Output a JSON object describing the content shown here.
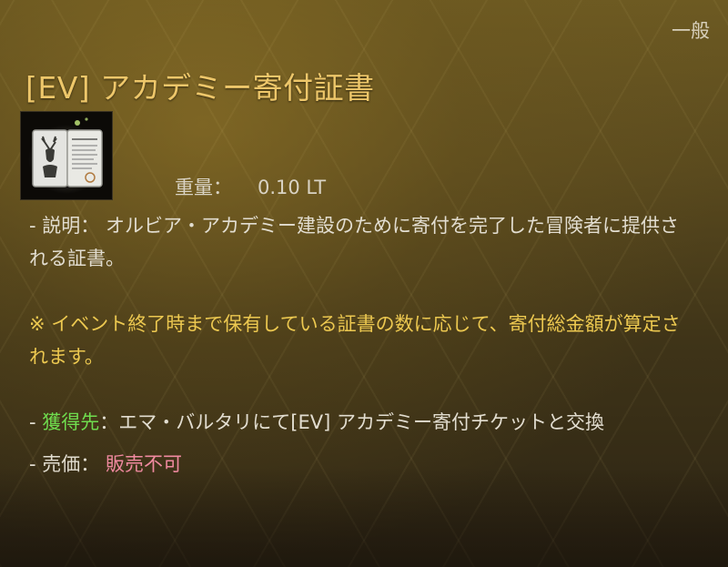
{
  "item": {
    "category": "一般",
    "title": "[EV] アカデミー寄付証書",
    "icon": "academy-certificate-icon",
    "weight_label": "重量：",
    "weight_value": "0.10 LT",
    "description_prefix": "- 説明：",
    "description_text": "オルビア・アカデミー建設のために寄付を完了した冒険者に提供される証書。",
    "notice": "※ イベント終了時まで保有している証書の数に応じて、寄付総金額が算定されます。",
    "acquisition_prefix": "- ",
    "acquisition_label": "獲得先",
    "acquisition_text": "：エマ・バルタリにて[EV] アカデミー寄付チケットと交換",
    "sell_label": "- 売価：",
    "sell_value": "販売不可"
  },
  "colors": {
    "title": "#eec76a",
    "notice": "#ecc850",
    "acquisition_label": "#6fdc4e",
    "sell_value": "#f08aa0"
  }
}
